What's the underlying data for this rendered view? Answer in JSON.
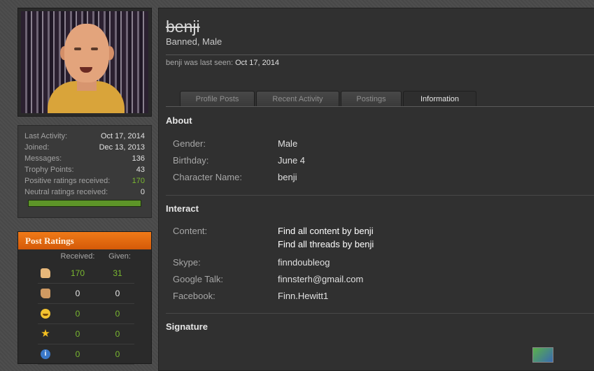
{
  "sidebar": {
    "stats": [
      {
        "label": "Last Activity:",
        "value": "Oct 17, 2014",
        "color": "#e2e2e2"
      },
      {
        "label": "Joined:",
        "value": "Dec 13, 2013",
        "color": "#e2e2e2"
      },
      {
        "label": "Messages:",
        "value": "136",
        "color": "#e2e2e2"
      },
      {
        "label": "Trophy Points:",
        "value": "43",
        "color": "#e2e2e2"
      },
      {
        "label": "Positive ratings received:",
        "value": "170",
        "color": "#7ab830"
      },
      {
        "label": "Neutral ratings received:",
        "value": "0",
        "color": "#e2e2e2"
      }
    ],
    "rating_bar_fraction": 1.0
  },
  "post_ratings": {
    "title": "Post Ratings",
    "col_received": "Received:",
    "col_given": "Given:",
    "rows": [
      {
        "icon": "thumbs-up-icon",
        "received": "170",
        "given": "31"
      },
      {
        "icon": "thumbs-down-icon",
        "received": "0",
        "given": "0"
      },
      {
        "icon": "funny-face-icon",
        "received": "0",
        "given": "0"
      },
      {
        "icon": "star-icon",
        "received": "0",
        "given": "0"
      },
      {
        "icon": "info-icon",
        "received": "0",
        "given": "0"
      }
    ]
  },
  "profile": {
    "username": "benji",
    "user_title": "Banned, Male",
    "last_seen_label": "benji was last seen:",
    "last_seen_date": "Oct 17, 2014"
  },
  "tabs": [
    {
      "label": "Profile Posts",
      "active": false
    },
    {
      "label": "Recent Activity",
      "active": false
    },
    {
      "label": "Postings",
      "active": false
    },
    {
      "label": "Information",
      "active": true
    }
  ],
  "about": {
    "title": "About",
    "gender_label": "Gender:",
    "gender": "Male",
    "birthday_label": "Birthday:",
    "birthday": "June 4",
    "character_label": "Character Name:",
    "character": "benji"
  },
  "interact": {
    "title": "Interact",
    "content_label": "Content:",
    "find_content": "Find all content by benji",
    "find_threads": "Find all threads by benji",
    "skype_label": "Skype:",
    "skype": "finndoubleog",
    "google_label": "Google Talk:",
    "google": "finnsterh@gmail.com",
    "facebook_label": "Facebook:",
    "facebook": "Finn.Hewitt1"
  },
  "signature": {
    "title": "Signature"
  },
  "colors": {
    "accent_orange": "#e86a10",
    "positive_green": "#7ab830"
  }
}
